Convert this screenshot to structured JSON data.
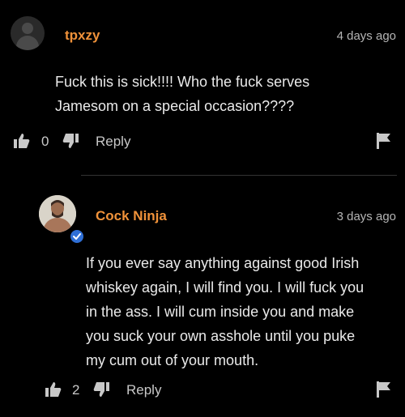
{
  "colors": {
    "background": "#000000",
    "username": "#f0923a",
    "text": "#eaeaea",
    "muted": "#b5b5b5",
    "verified": "#2f6fd6"
  },
  "comments": [
    {
      "username": "tpxzy",
      "timestamp": "4 days ago",
      "text_lines": [
        "Fuck this is sick!!!! Who the fuck serves",
        "Jamesom on a special occasion????"
      ],
      "likes": "0",
      "reply_label": "Reply",
      "avatar_icon": "default-avatar-icon"
    },
    {
      "username": "Cock Ninja",
      "timestamp": "3 days ago",
      "text_lines": [
        "If you ever say anything against good Irish",
        "whiskey again, I will find you. I will fuck you",
        "in the ass. I will cum inside you and make",
        "you suck your own asshole until you puke",
        "my cum out of your mouth."
      ],
      "likes": "2",
      "reply_label": "Reply",
      "verified": true,
      "avatar_icon": "user-photo-avatar"
    }
  ],
  "icons": {
    "like": "thumbs-up-icon",
    "dislike": "thumbs-down-icon",
    "flag": "flag-icon",
    "verified": "verified-check-icon"
  }
}
